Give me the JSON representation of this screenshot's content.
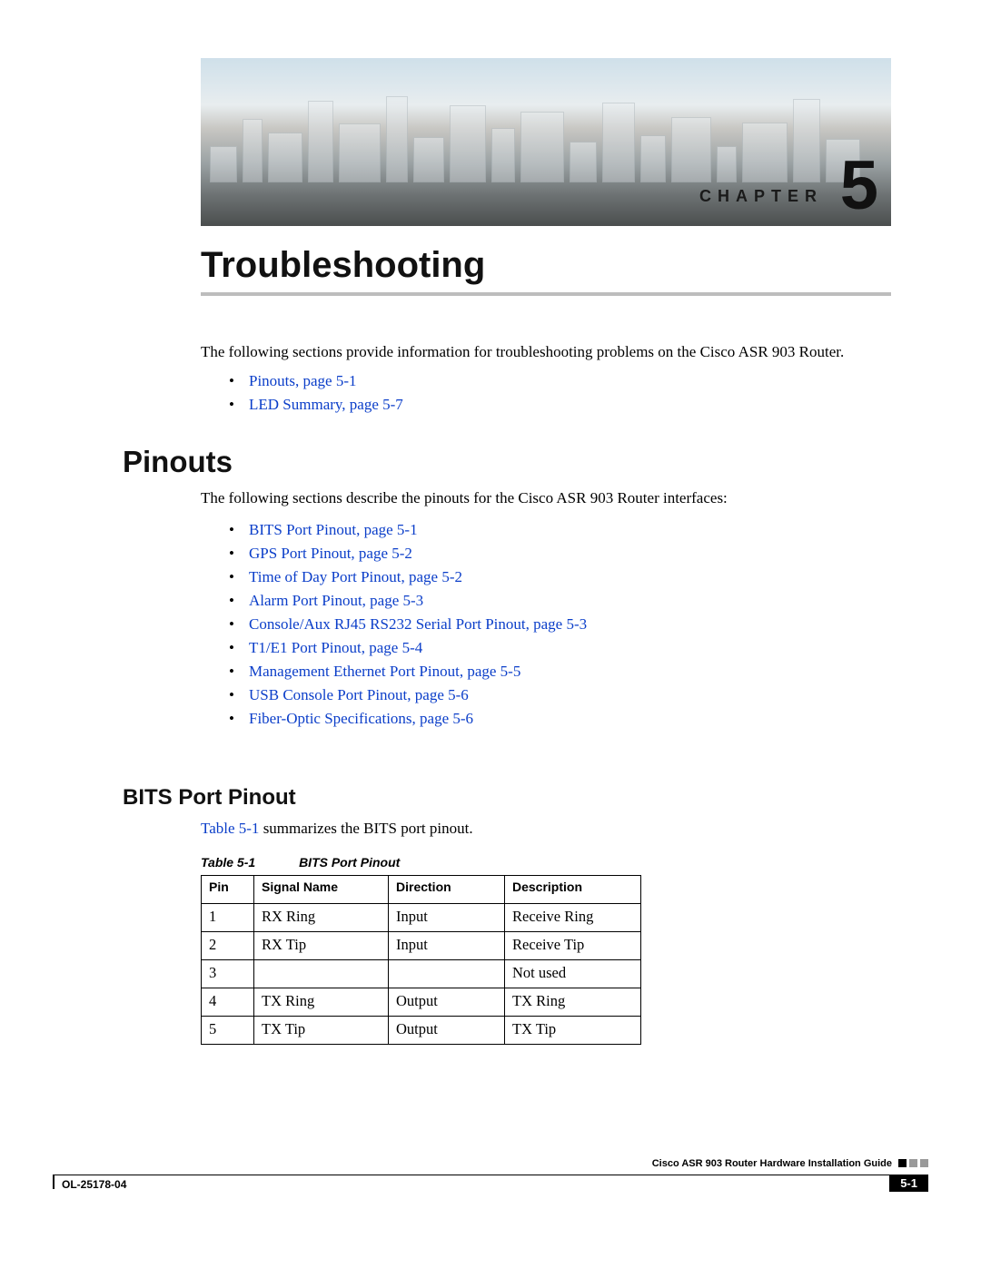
{
  "banner": {
    "chapter_label": "CHAPTER",
    "chapter_number": "5"
  },
  "headings": {
    "h1": "Troubleshooting",
    "h2_pinouts": "Pinouts",
    "h3_bits": "BITS Port Pinout"
  },
  "body": {
    "intro": "The following sections provide information for troubleshooting problems on the Cisco ASR 903 Router.",
    "pinouts_intro": "The following sections describe the pinouts for the Cisco ASR 903 Router interfaces:",
    "table_ref_prefix": "Table 5-1",
    "table_ref_rest": " summarizes the BITS port pinout."
  },
  "toc_top": [
    "Pinouts, page 5-1",
    "LED Summary, page 5-7"
  ],
  "toc_pinouts": [
    "BITS Port Pinout, page 5-1",
    "GPS Port Pinout, page 5-2",
    "Time of Day Port Pinout, page 5-2",
    "Alarm Port Pinout, page 5-3",
    "Console/Aux RJ45 RS232 Serial Port Pinout, page 5-3",
    "T1/E1 Port Pinout, page 5-4",
    "Management Ethernet Port Pinout, page 5-5",
    "USB Console Port Pinout, page 5-6",
    "Fiber-Optic Specifications, page 5-6"
  ],
  "table": {
    "caption_label": "Table 5-1",
    "caption_title": "BITS Port Pinout",
    "headers": {
      "c1": "Pin",
      "c2": "Signal Name",
      "c3": "Direction",
      "c4": "Description"
    },
    "rows": [
      {
        "pin": "1",
        "signal": "RX Ring",
        "dir": "Input",
        "desc": "Receive Ring"
      },
      {
        "pin": "2",
        "signal": "RX Tip",
        "dir": "Input",
        "desc": "Receive Tip"
      },
      {
        "pin": "3",
        "signal": "",
        "dir": "",
        "desc": "Not used"
      },
      {
        "pin": "4",
        "signal": "TX Ring",
        "dir": "Output",
        "desc": "TX Ring"
      },
      {
        "pin": "5",
        "signal": "TX Tip",
        "dir": "Output",
        "desc": "TX Tip"
      }
    ]
  },
  "footer": {
    "guide": "Cisco ASR 903 Router Hardware Installation Guide",
    "doc_number": "OL-25178-04",
    "page_number": "5-1"
  }
}
